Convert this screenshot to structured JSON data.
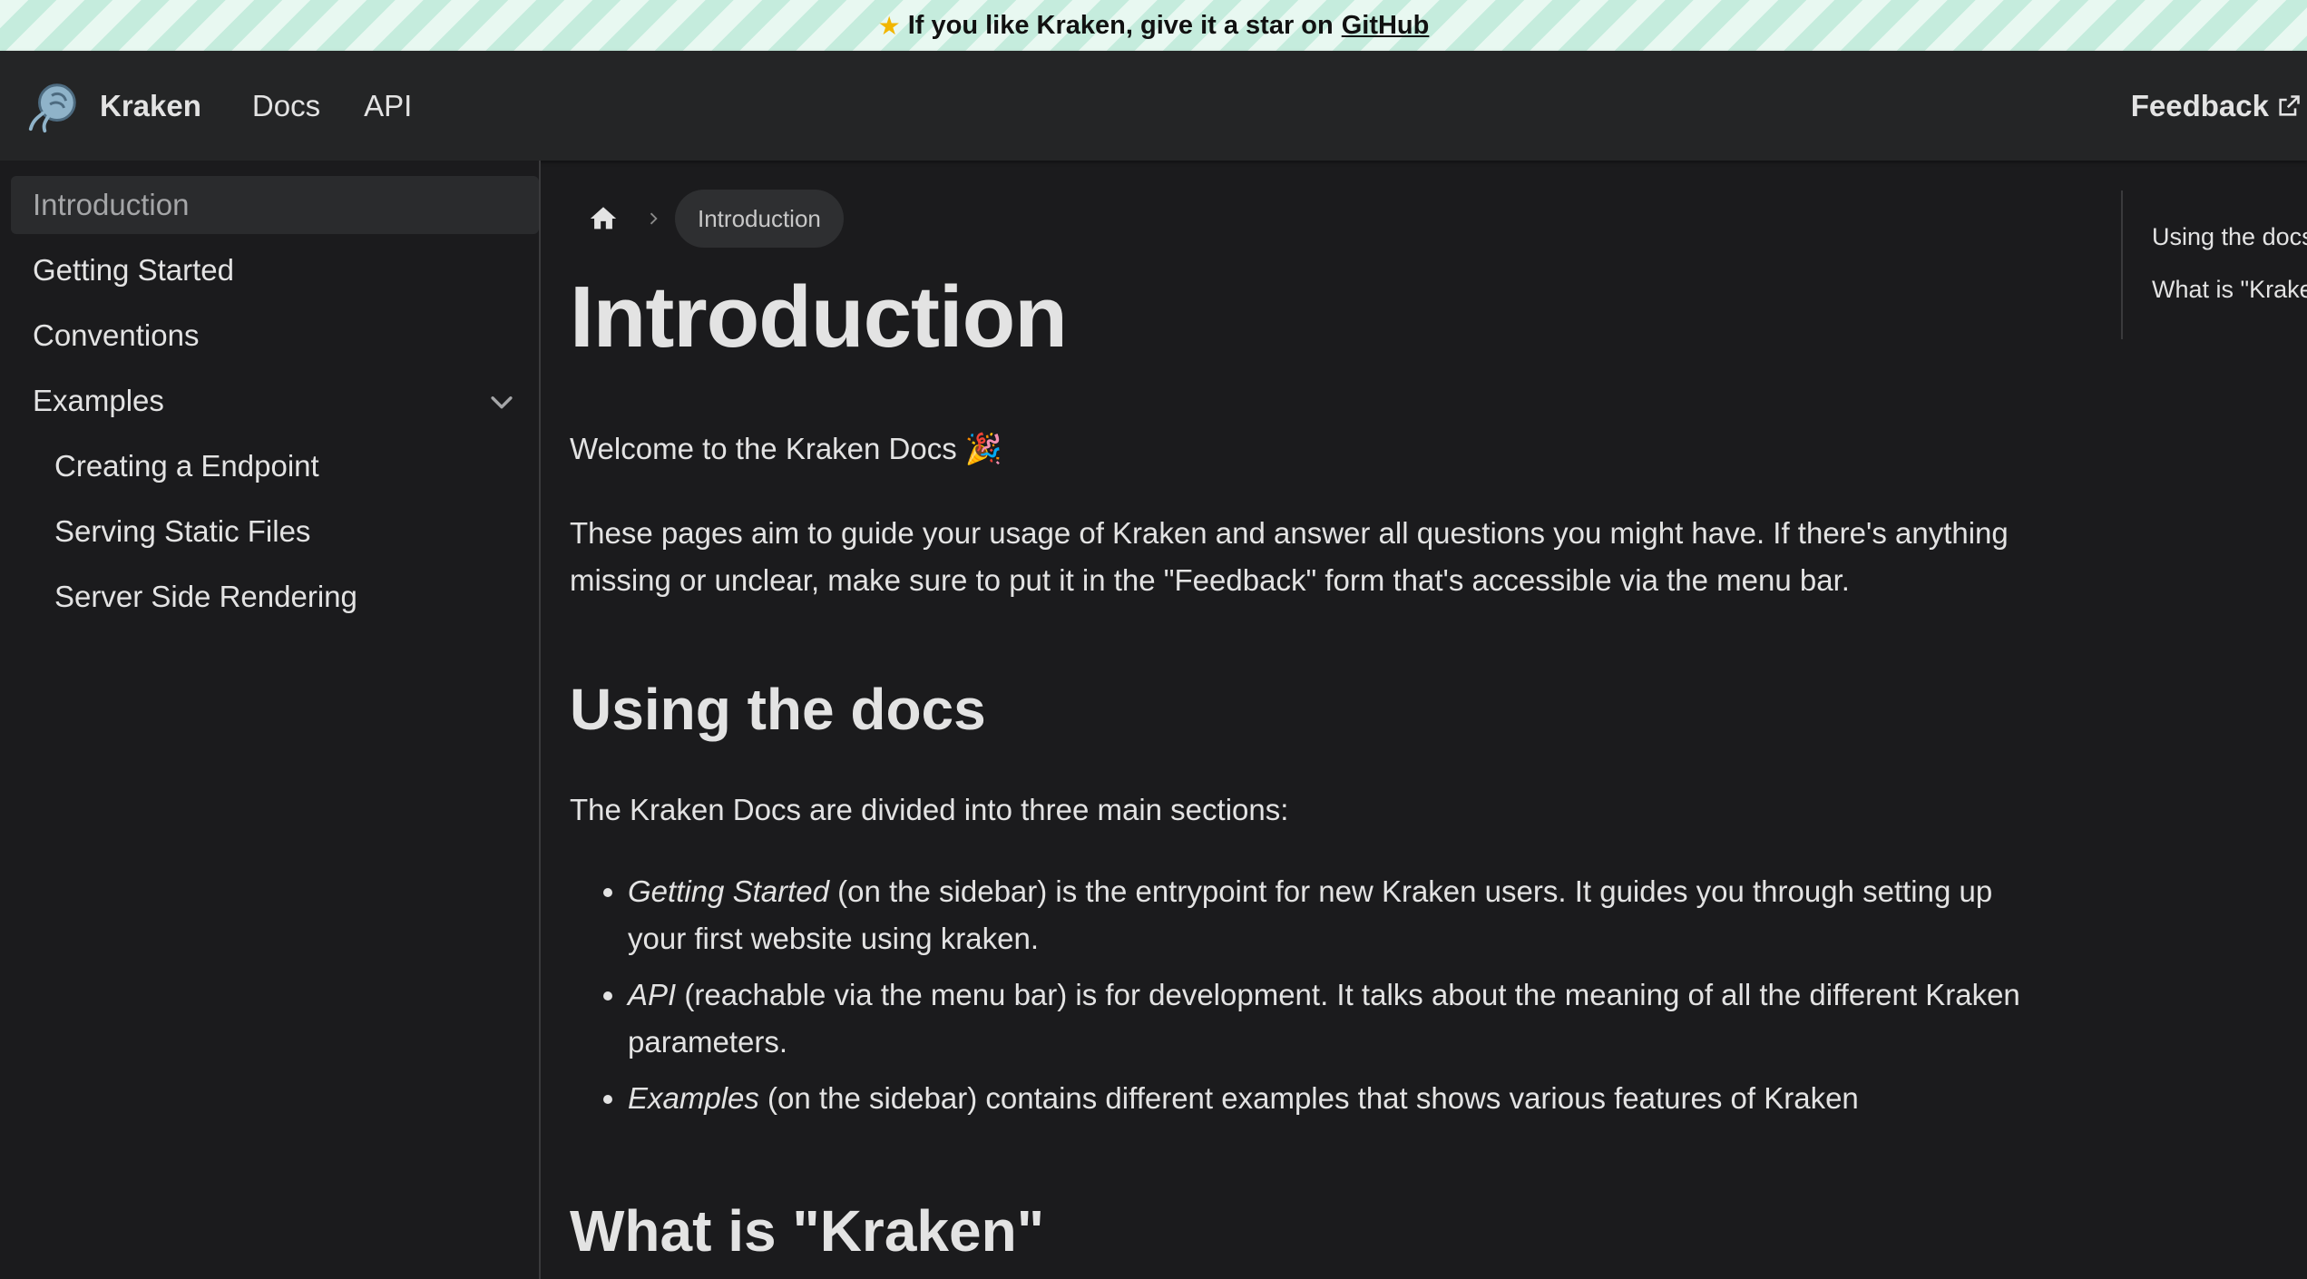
{
  "announcement": {
    "prefix": "If you like Kraken, give it a star on",
    "link": "GitHub"
  },
  "navbar": {
    "brand": "Kraken",
    "links": [
      "Docs",
      "API"
    ],
    "feedback": "Feedback"
  },
  "sidebar": {
    "items": [
      {
        "label": "Introduction",
        "active": true
      },
      {
        "label": "Getting Started"
      },
      {
        "label": "Conventions"
      },
      {
        "label": "Examples",
        "expanded": true
      },
      {
        "label": "Creating a Endpoint",
        "sub": true
      },
      {
        "label": "Serving Static Files",
        "sub": true
      },
      {
        "label": "Server Side Rendering",
        "sub": true
      }
    ]
  },
  "breadcrumb": {
    "current": "Introduction"
  },
  "content": {
    "title": "Introduction",
    "welcome": "Welcome to the Kraken Docs 🎉",
    "intro": "These pages aim to guide your usage of Kraken and answer all questions you might have. If there's anything missing or unclear, make sure to put it in the \"Feedback\" form that's accessible via the menu bar.",
    "section1_title": "Using the docs",
    "section1_intro": "The Kraken Docs are divided into three main sections:",
    "bullets": [
      {
        "em": "Getting Started",
        "text": " (on the sidebar) is the entrypoint for new Kraken users. It guides you through setting up your first website using kraken."
      },
      {
        "em": "API",
        "text": " (reachable via the menu bar) is for development. It talks about the meaning of all the different Kraken parameters."
      },
      {
        "em": "Examples",
        "text": " (on the sidebar) contains different examples that shows various features of Kraken"
      }
    ],
    "section2_title": "What is \"Kraken\""
  },
  "toc": {
    "items": [
      "Using the docs",
      "What is \"Kraken\""
    ]
  },
  "colors": {
    "background": "#1b1b1d",
    "navbar": "#242526",
    "text": "#e3e3e3",
    "active_item_bg": "#2a2b2d"
  }
}
